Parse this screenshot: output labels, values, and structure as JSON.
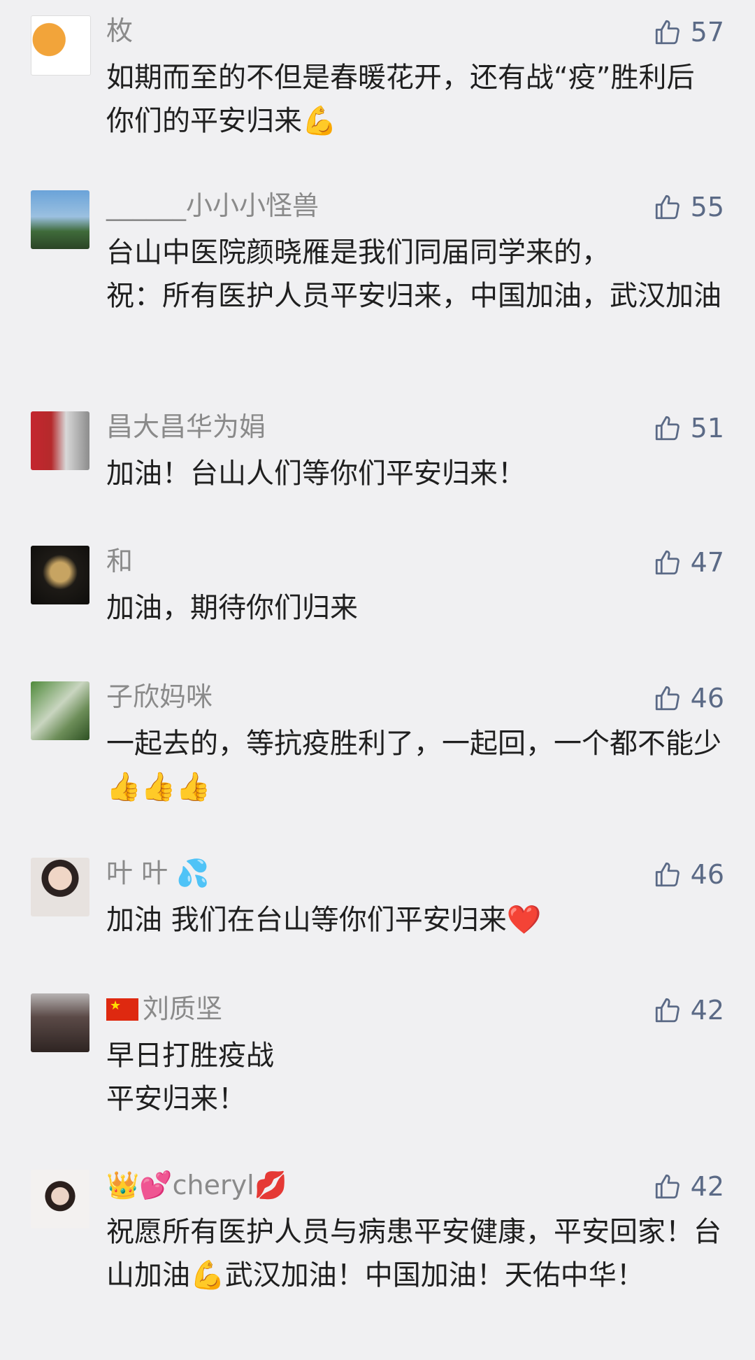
{
  "comments": [
    {
      "name": "枚",
      "likes": "57",
      "text": "如期而至的不但是春暖花开，还有战“疫”胜利后你们的平安归来💪"
    },
    {
      "name": "______小小小怪兽",
      "likes": "55",
      "text": "台山中医院颜晓雁是我们同届同学来的，\n祝：所有医护人员平安归来，中国加油，武汉加油"
    },
    {
      "name": "昌大昌华为娟",
      "likes": "51",
      "text": "加油！台山人们等你们平安归来！"
    },
    {
      "name": "和",
      "likes": "47",
      "text": "加油，期待你们归来"
    },
    {
      "name": "子欣妈咪",
      "likes": "46",
      "text": "一起去的，等抗疫胜利了，一起回，一个都不能少👍👍👍"
    },
    {
      "name": "叶 叶 💦",
      "likes": "46",
      "text": "加油 我们在台山等你们平安归来❤️"
    },
    {
      "name": "刘质坚",
      "likes": "42",
      "text": "早日打胜疫战\n平安归来！"
    },
    {
      "name": "👑💕cheryl💋",
      "likes": "42",
      "text": "祝愿所有医护人员与病患平安健康，平安回家！台山加油💪武汉加油！中国加油！天佑中华！"
    }
  ],
  "colors": {
    "like": "#5b6a86",
    "name": "#8a8a8a",
    "text": "#1f1f1f",
    "background": "#f0f0f2"
  },
  "icons": {
    "like": "thumbs-up-icon",
    "flag": "china-flag-icon"
  }
}
